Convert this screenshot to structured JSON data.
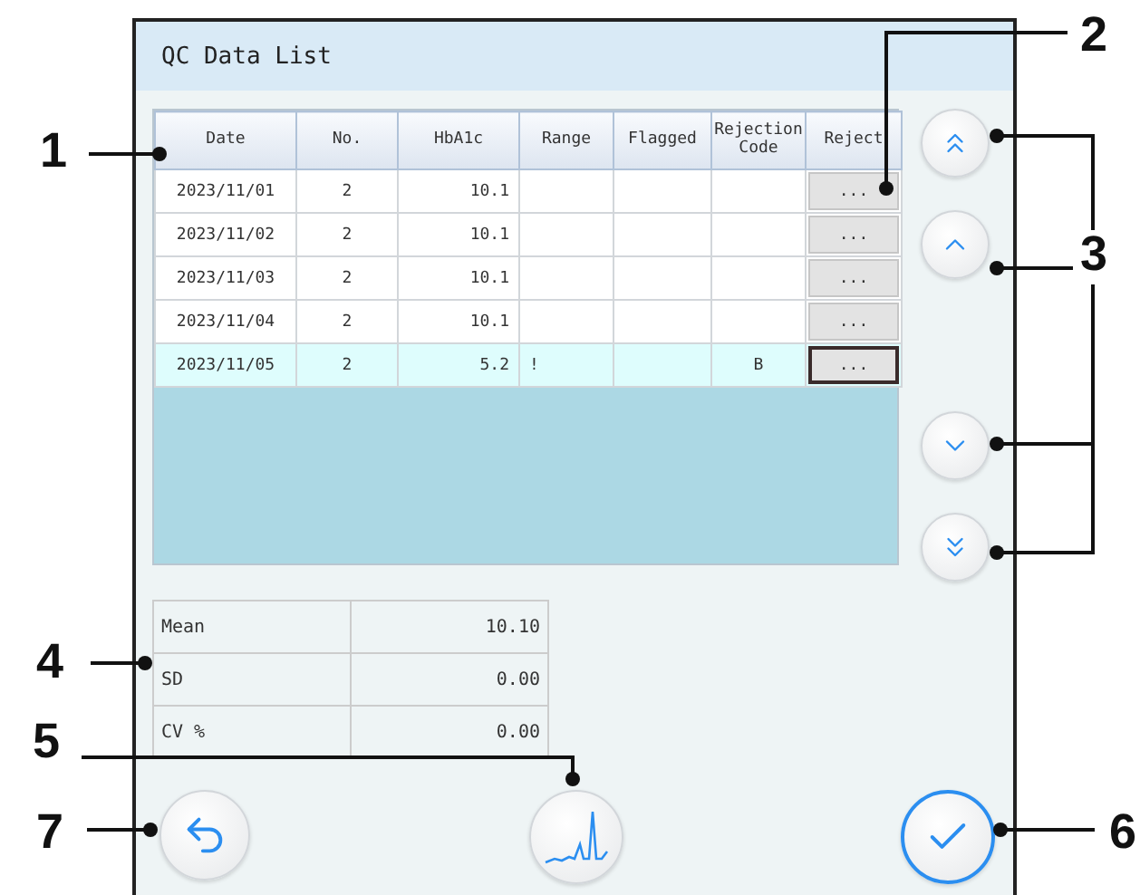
{
  "screen": {
    "title": "QC Data List"
  },
  "table": {
    "columns": [
      "Date",
      "No.",
      "HbA1c",
      "Range",
      "Flagged",
      "Rejection Code",
      "Reject"
    ],
    "rows": [
      {
        "date": "2023/11/01",
        "no": "2",
        "hba1c": "10.1",
        "range": "",
        "flagged": "",
        "rejection_code": "",
        "reject": "...",
        "selected": false
      },
      {
        "date": "2023/11/02",
        "no": "2",
        "hba1c": "10.1",
        "range": "",
        "flagged": "",
        "rejection_code": "",
        "reject": "...",
        "selected": false
      },
      {
        "date": "2023/11/03",
        "no": "2",
        "hba1c": "10.1",
        "range": "",
        "flagged": "",
        "rejection_code": "",
        "reject": "...",
        "selected": false
      },
      {
        "date": "2023/11/04",
        "no": "2",
        "hba1c": "10.1",
        "range": "",
        "flagged": "",
        "rejection_code": "",
        "reject": "...",
        "selected": false
      },
      {
        "date": "2023/11/05",
        "no": "2",
        "hba1c": "5.2",
        "range": "!",
        "flagged": "",
        "rejection_code": "B",
        "reject": "...",
        "selected": true
      }
    ]
  },
  "scroll_buttons": [
    {
      "kind": "top"
    },
    {
      "kind": "up"
    },
    {
      "kind": "down"
    },
    {
      "kind": "bottom"
    }
  ],
  "stats": [
    {
      "label": "Mean",
      "value": "10.10"
    },
    {
      "label": "SD",
      "value": "0.00"
    },
    {
      "label": "CV %",
      "value": "0.00"
    }
  ],
  "bottom_buttons": [
    {
      "kind": "back"
    },
    {
      "kind": "chart"
    },
    {
      "kind": "confirm"
    }
  ],
  "callouts": [
    {
      "label": "2"
    },
    {
      "label": "1"
    },
    {
      "label": "3"
    },
    {
      "label": "4"
    },
    {
      "label": "5"
    },
    {
      "label": "7"
    },
    {
      "label": "6"
    }
  ]
}
